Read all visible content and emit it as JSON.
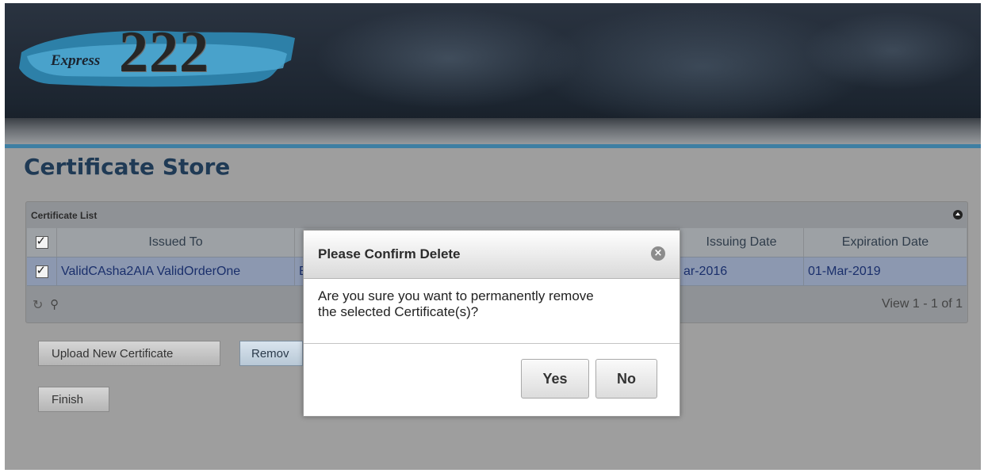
{
  "header": {
    "logo_word": "Express",
    "logo_number": "222"
  },
  "page": {
    "title": "Certificate Store"
  },
  "grid": {
    "caption": "Certificate List",
    "columns": [
      "Issued To",
      "",
      "Issuing Date",
      "Expiration Date"
    ],
    "rows": [
      {
        "issued_to": "ValidCAsha2AIA ValidOrderOne",
        "issued_by": "E",
        "issuing_date": "ar-2016",
        "expiration_date": "01-Mar-2019"
      }
    ],
    "pager_info": "View 1 - 1 of 1"
  },
  "buttons": {
    "upload": "Upload New Certificate",
    "remove": "Remov",
    "finish": "Finish"
  },
  "dialog": {
    "title": "Please Confirm Delete",
    "message_line1": "Are you sure you want to permanently remove",
    "message_line2": "the selected Certificate(s)?",
    "yes": "Yes",
    "no": "No"
  },
  "icons": {
    "collapse": "collapse-icon",
    "refresh": "refresh-icon",
    "search": "search-icon",
    "close": "close-icon"
  },
  "colors": {
    "accent_line": "#3e7fa3",
    "title": "#1f3a55",
    "row_selected": "#8c98b0"
  }
}
